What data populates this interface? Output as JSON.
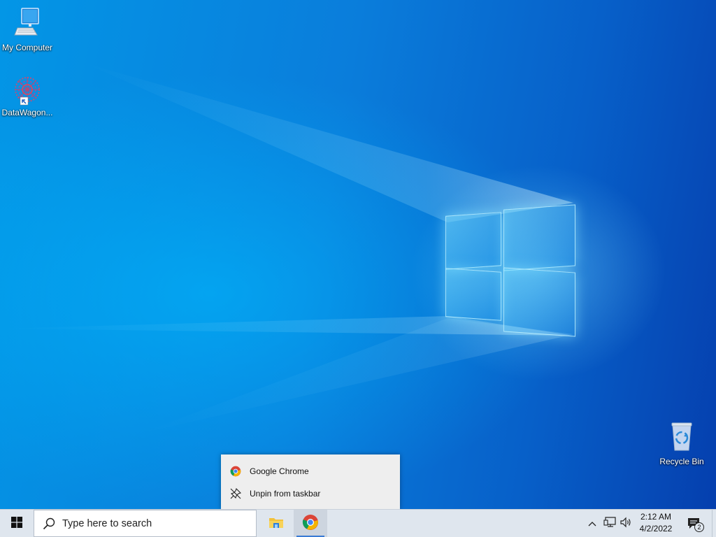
{
  "desktop": {
    "icons": [
      {
        "label": "My Computer",
        "icon": "computer-icon"
      },
      {
        "label": "DataWagon...",
        "icon": "datawagon-shortcut-icon"
      },
      {
        "label": "Recycle Bin",
        "icon": "recycle-bin-icon"
      }
    ]
  },
  "context_menu": {
    "items": [
      {
        "label": "Google Chrome",
        "icon": "chrome-icon"
      },
      {
        "label": "Unpin from taskbar",
        "icon": "unpin-icon"
      }
    ]
  },
  "taskbar": {
    "start_icon": "windows-logo-icon",
    "search": {
      "placeholder": "Type here to search",
      "icon": "search-icon"
    },
    "apps": [
      {
        "name": "File Explorer",
        "icon": "file-explorer-icon",
        "active": false
      },
      {
        "name": "Google Chrome",
        "icon": "chrome-icon",
        "active": true
      }
    ],
    "tray": {
      "icons": [
        "chevron-up-icon",
        "network-icon",
        "volume-icon"
      ],
      "time": "2:12 AM",
      "date": "4/2/2022",
      "notifications_count": "2"
    }
  },
  "colors": {
    "taskbar_bg": "#dfe6ee",
    "menu_bg": "#eeeeee",
    "accent": "#3a7bd5"
  }
}
